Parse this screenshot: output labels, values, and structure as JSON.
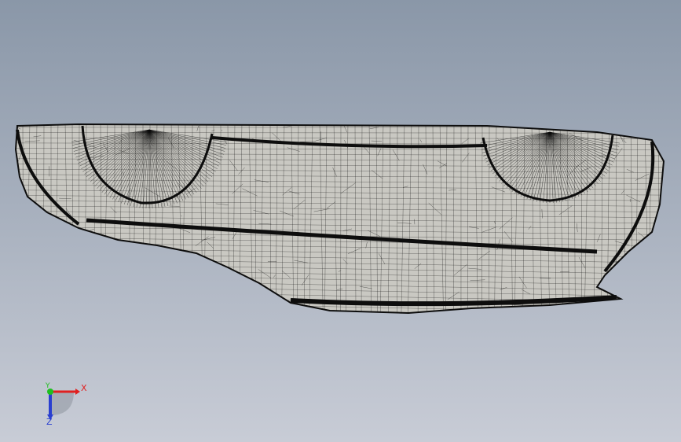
{
  "viewport": {
    "background_top": "#8a97a8",
    "background_bottom": "#c8ccd6",
    "model_fill": "#c9c8c2",
    "mesh_color": "#0d0d0d"
  },
  "triad": {
    "x_label": "X",
    "y_label": "Y",
    "z_label": "Z",
    "x_color": "#e02020",
    "y_color": "#1fc01f",
    "z_color": "#2a3fd0"
  }
}
